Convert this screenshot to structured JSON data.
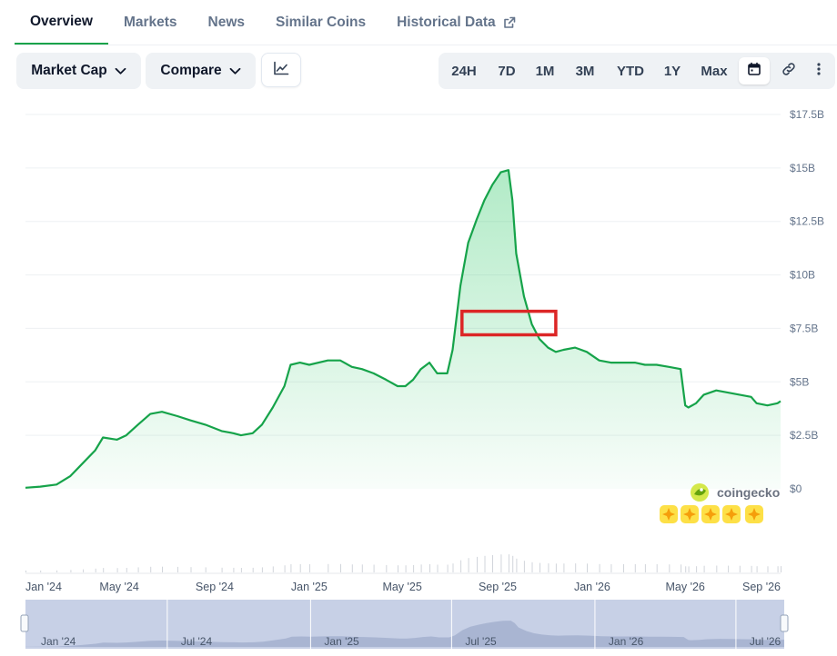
{
  "tabs": [
    {
      "label": "Overview",
      "active": true
    },
    {
      "label": "Markets",
      "active": false
    },
    {
      "label": "News",
      "active": false
    },
    {
      "label": "Similar Coins",
      "active": false
    },
    {
      "label": "Historical Data",
      "active": false,
      "external": true
    }
  ],
  "toolbar": {
    "metric_label": "Market Cap",
    "compare_label": "Compare",
    "chart_type_icon": "line-chart-icon",
    "ranges": [
      "24H",
      "7D",
      "1M",
      "3M",
      "YTD",
      "1Y",
      "Max"
    ],
    "icons": [
      "calendar-icon",
      "link-icon",
      "more-vertical-icon"
    ]
  },
  "colors": {
    "line": "#16a34a",
    "fill": "#22c55e",
    "highlight_box": "#dc2626",
    "navigator": "#c7d0e6"
  },
  "watermark": {
    "brand": "coingecko"
  },
  "chart_data": {
    "type": "area",
    "title": "",
    "xlabel": "",
    "ylabel": "",
    "ylim": [
      0,
      17.5
    ],
    "yticks": [
      0,
      2.5,
      5,
      7.5,
      10,
      12.5,
      15,
      17.5
    ],
    "ytick_labels": [
      "$0",
      "$2.5B",
      "$5B",
      "$7.5B",
      "$10B",
      "$12.5B",
      "$15B",
      "$17.5B"
    ],
    "xticks": [
      "2024-01-01",
      "2024-05-01",
      "2024-09-01",
      "2025-01-01",
      "2025-05-01",
      "2025-09-01",
      "2026-01-01",
      "2026-05-01",
      "2026-09-01"
    ],
    "xtick_labels": [
      "Jan '24",
      "May '24",
      "Sep '24",
      "Jan '25",
      "May '25",
      "Sep '25",
      "Jan '26",
      "May '26",
      "Sep '26"
    ],
    "xlim": [
      "2024-01-01",
      "2026-09-01"
    ],
    "grid": true,
    "series": [
      {
        "x": [
          "2024-01-01",
          "2024-01-20",
          "2024-02-10",
          "2024-02-28",
          "2024-03-15",
          "2024-03-31",
          "2024-04-10",
          "2024-04-28",
          "2024-05-10",
          "2024-05-25",
          "2024-06-10",
          "2024-06-25",
          "2024-07-15",
          "2024-08-01",
          "2024-08-20",
          "2024-09-10",
          "2024-09-25",
          "2024-10-05",
          "2024-10-20",
          "2024-11-01",
          "2024-11-15",
          "2024-11-30",
          "2024-12-08",
          "2024-12-20",
          "2025-01-01",
          "2025-01-25",
          "2025-02-10",
          "2025-02-25",
          "2025-03-10",
          "2025-03-25",
          "2025-04-10",
          "2025-04-25",
          "2025-05-05",
          "2025-05-15",
          "2025-05-25",
          "2025-06-05",
          "2025-06-15",
          "2025-06-28",
          "2025-07-05",
          "2025-07-15",
          "2025-07-25",
          "2025-08-05",
          "2025-08-15",
          "2025-08-25",
          "2025-09-05",
          "2025-09-15",
          "2025-09-20",
          "2025-09-25",
          "2025-10-05",
          "2025-10-15",
          "2025-10-25",
          "2025-11-05",
          "2025-11-15",
          "2025-11-25",
          "2025-12-10",
          "2025-12-25",
          "2026-01-10",
          "2026-01-25",
          "2026-02-10",
          "2026-02-25",
          "2026-03-10",
          "2026-03-25",
          "2026-04-10",
          "2026-04-25",
          "2026-05-01",
          "2026-05-05",
          "2026-05-15",
          "2026-05-25",
          "2026-06-10",
          "2026-06-25",
          "2026-07-10",
          "2026-07-25",
          "2026-08-01",
          "2026-08-15",
          "2026-08-28",
          "2026-09-01"
        ],
        "y": [
          0.05,
          0.1,
          0.2,
          0.6,
          1.2,
          1.8,
          2.4,
          2.3,
          2.5,
          3.0,
          3.5,
          3.6,
          3.4,
          3.2,
          3.0,
          2.7,
          2.6,
          2.5,
          2.6,
          3.0,
          3.8,
          4.8,
          5.8,
          5.9,
          5.8,
          6.0,
          6.0,
          5.7,
          5.6,
          5.4,
          5.1,
          4.8,
          4.8,
          5.1,
          5.6,
          5.9,
          5.4,
          5.4,
          6.5,
          9.5,
          11.5,
          12.6,
          13.5,
          14.2,
          14.8,
          14.9,
          13.5,
          11.0,
          9.0,
          7.7,
          7.0,
          6.6,
          6.4,
          6.5,
          6.6,
          6.4,
          6.0,
          5.9,
          5.9,
          5.9,
          5.8,
          5.8,
          5.7,
          5.6,
          3.9,
          3.8,
          4.0,
          4.4,
          4.6,
          4.5,
          4.4,
          4.3,
          4.0,
          3.9,
          4.0,
          4.1
        ]
      }
    ],
    "annotations": [
      {
        "type": "rect",
        "color": "#dc2626",
        "x": [
          "2025-07-17",
          "2025-11-15"
        ],
        "y": [
          7.2,
          8.3
        ]
      }
    ],
    "navigator": {
      "xtick_labels": [
        "Jan '24",
        "Jul '24",
        "Jan '25",
        "Jul '25",
        "Jan '26",
        "Jul '26"
      ],
      "xticks": [
        "2024-01-01",
        "2024-07-01",
        "2025-01-01",
        "2025-07-01",
        "2026-01-01",
        "2026-07-01"
      ]
    }
  }
}
